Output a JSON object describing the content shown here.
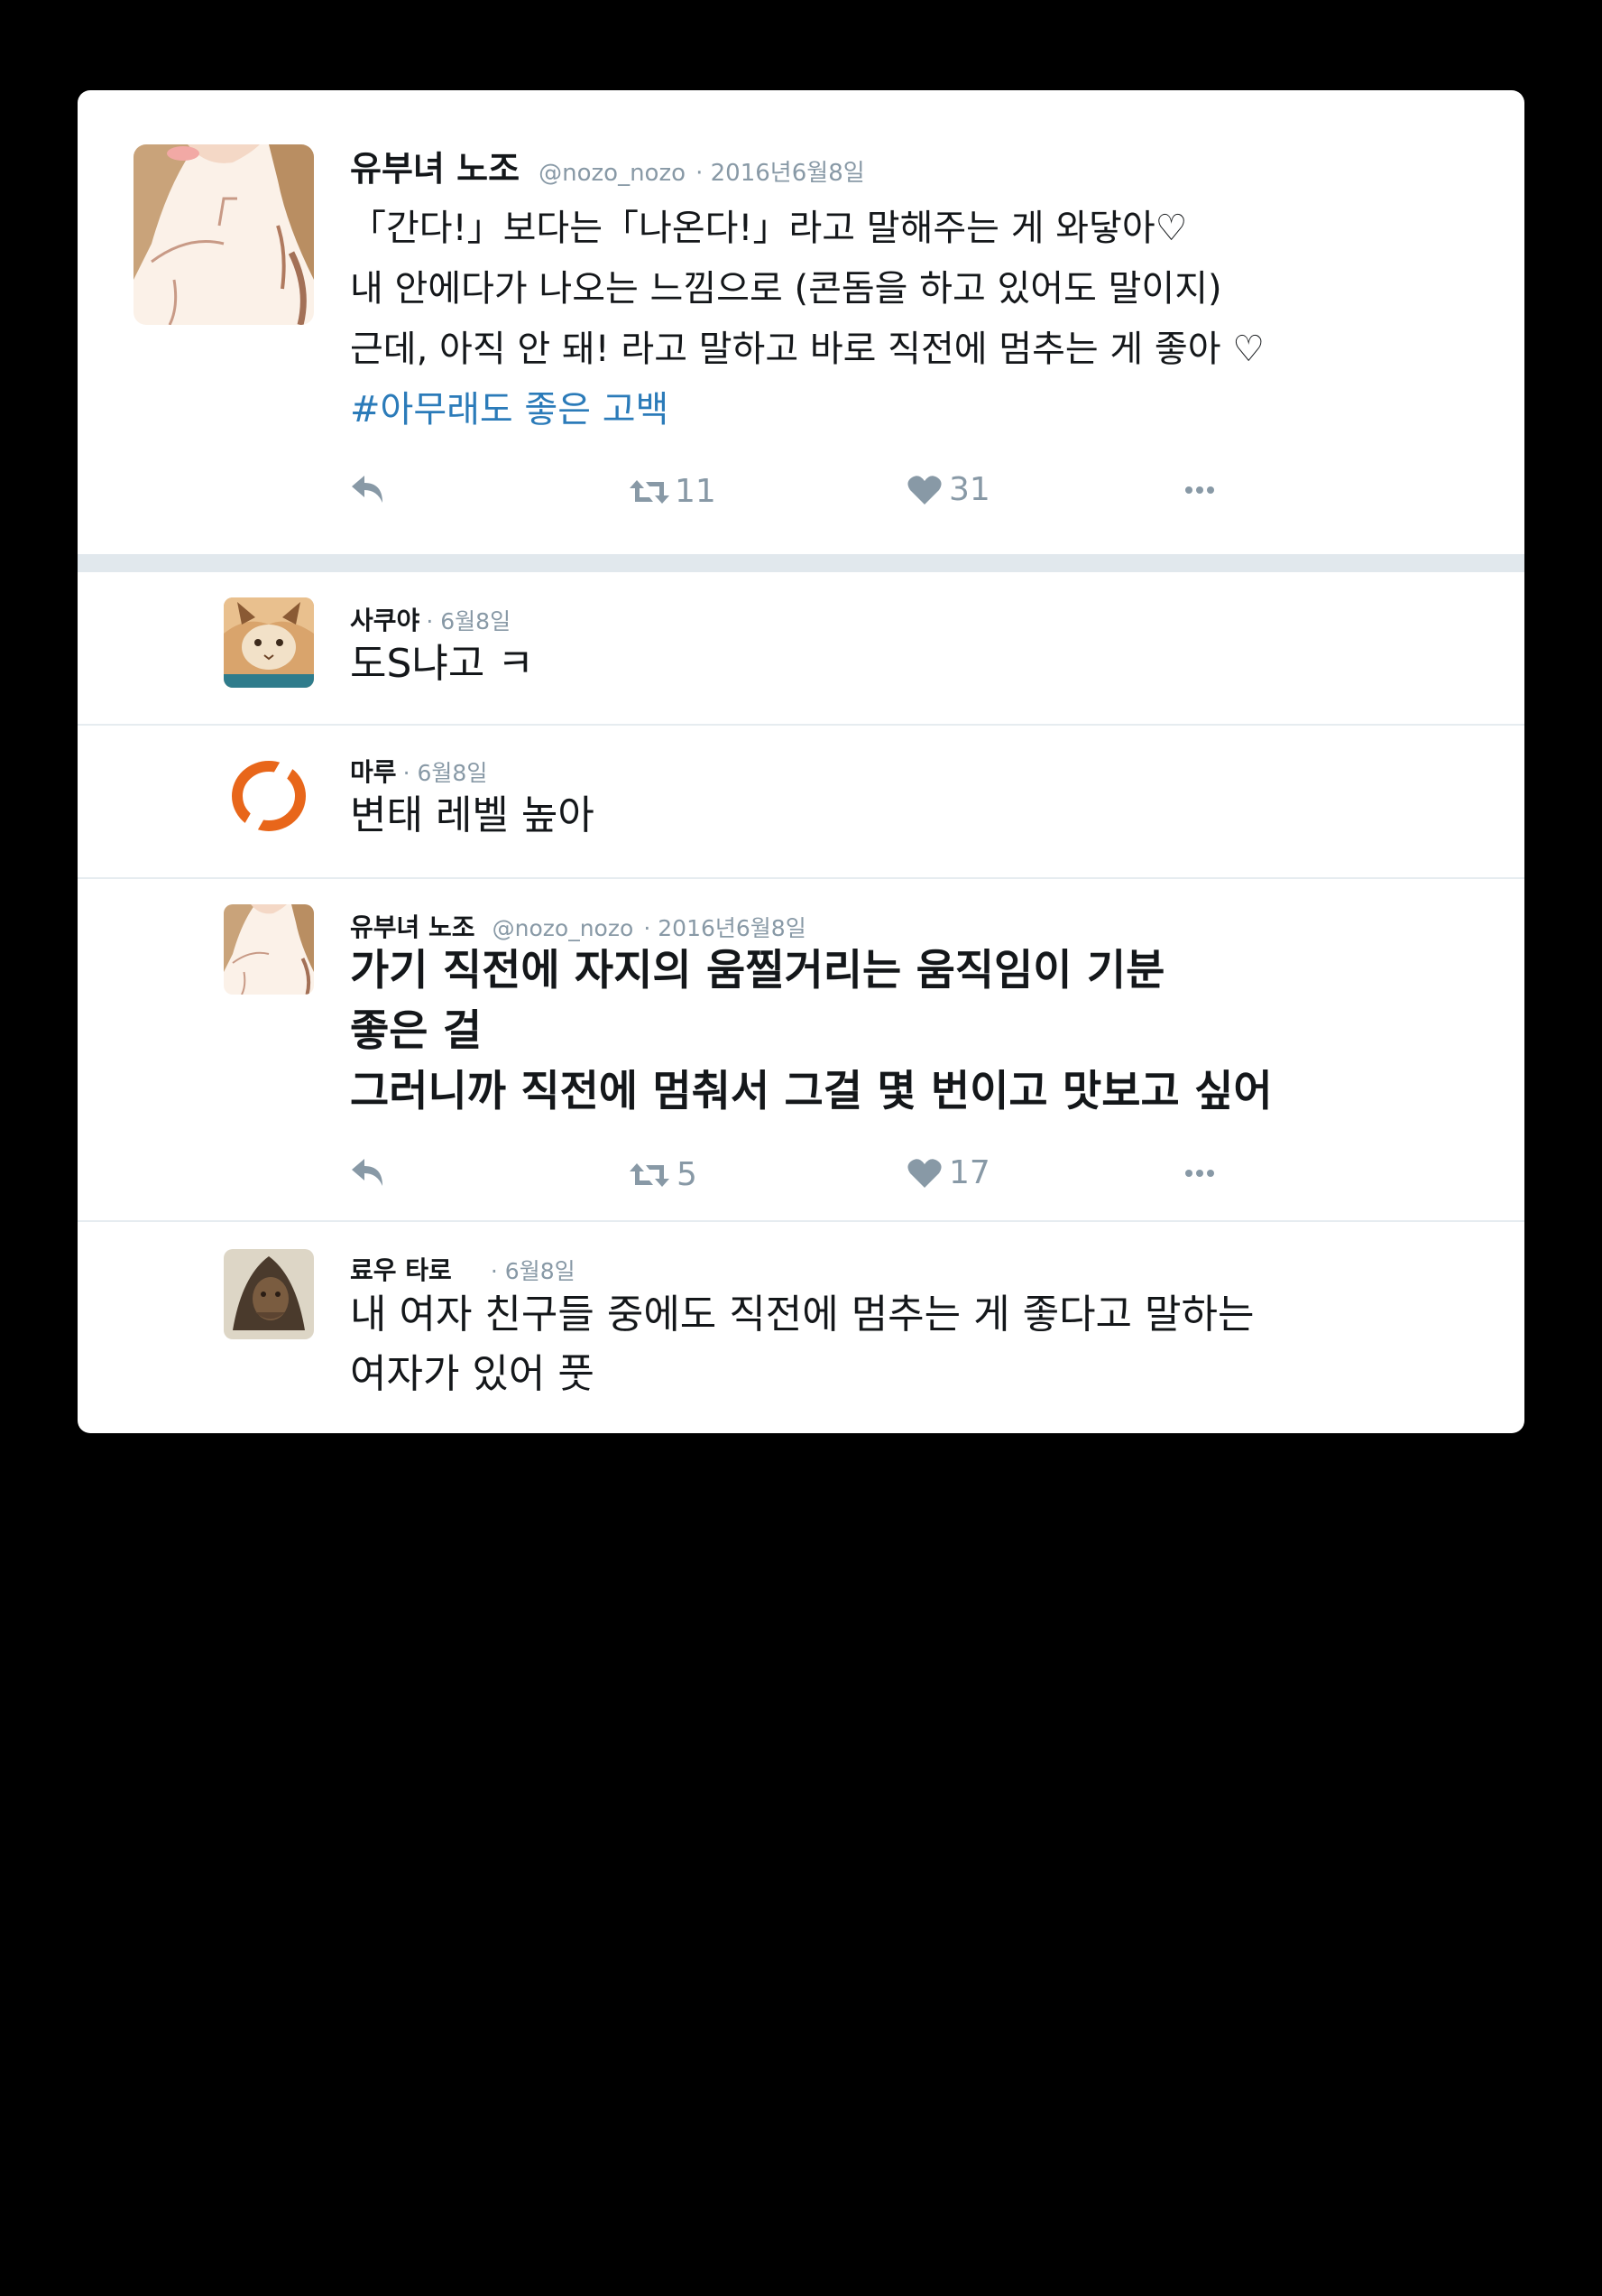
{
  "main_tweet": {
    "name": "유부녀 노조",
    "handle": "@nozo_nozo",
    "date": "· 2016년6월8일",
    "lines": [
      "「간다!」보다는「나온다!」라고 말해주는 게 와닿아♡",
      "내 안에다가 나오는 느낌으로 (콘돔을 하고 있어도 말이지)",
      "근데, 아직 안 돼! 라고 말하고 바로 직전에 멈추는 게 좋아 ♡"
    ],
    "hashtag": "#아무래도 좋은 고백",
    "retweets": "11",
    "likes": "31"
  },
  "replies": [
    {
      "name": "사쿠야",
      "date": "· 6월8일",
      "text": "도S냐고 ㅋ"
    },
    {
      "name": "마루",
      "date": "· 6월8일",
      "text": "변태 레벨 높아"
    }
  ],
  "self_reply": {
    "name": "유부녀 노조",
    "handle": "@nozo_nozo",
    "date": "· 2016년6월8일",
    "lines": [
      "가기 직전에 자지의 움찔거리는 움직임이 기분",
      "좋은 걸",
      "그러니까 직전에 멈춰서 그걸 몇 번이고 맛보고 싶어"
    ],
    "retweets": "5",
    "likes": "17"
  },
  "last_reply": {
    "name": "료우 타로",
    "date": "· 6월8일",
    "lines": [
      "내 여자 친구들 중에도 직전에 멈추는 게 좋다고 말하는",
      "여자가 있어 풋"
    ]
  },
  "icons": {
    "reply": "reply-icon",
    "retweet": "retweet-icon",
    "like": "heart-icon",
    "more": "more-icon"
  },
  "colors": {
    "background": "#000000",
    "card": "#ffffff",
    "text": "#14171a",
    "meta": "#8899a6",
    "hashtag": "#2b7bb9",
    "separator_band": "#e1e8ed",
    "maru_logo": "#e8661a"
  }
}
